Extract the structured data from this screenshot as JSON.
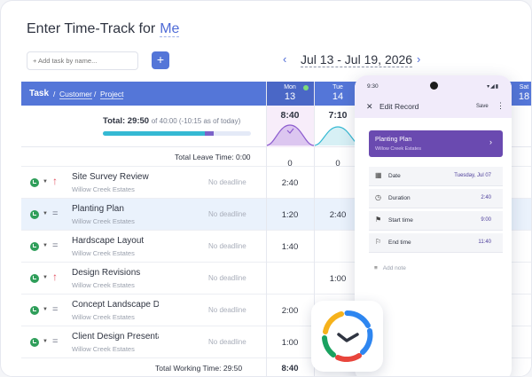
{
  "header": {
    "title_prefix": "Enter Time-Track for",
    "title_user": "Me",
    "add_task_placeholder": "+ Add task by name...",
    "add_button": "+",
    "date_range": "Jul 13 - Jul 19, 2026",
    "prev": "‹",
    "next": "›"
  },
  "table": {
    "col_task": "Task",
    "col_customer": "Customer",
    "col_project": "Project",
    "sep": "/",
    "days": [
      {
        "dow": "Mon",
        "num": "13"
      },
      {
        "dow": "Tue",
        "num": "14"
      },
      {
        "dow": "Sat",
        "num": "18"
      }
    ],
    "summary": {
      "label": "Total: 29:50",
      "sub": "of 40:00 (-10:15 as of today)",
      "progress_cyan": 0.69,
      "progress_purple": 0.06,
      "day_totals": [
        "8:40",
        "7:10"
      ]
    },
    "leave": {
      "label": "Total Leave Time: 0:00",
      "values": [
        "0",
        "0"
      ]
    },
    "rows": [
      {
        "name": "Site Survey Review",
        "client": "Willow Creek Estates",
        "deadline": "No deadline",
        "priority": "up",
        "mon": "2:40",
        "tue": ""
      },
      {
        "name": "Planting Plan",
        "client": "Willow Creek Estates",
        "deadline": "No deadline",
        "priority": "eq",
        "mon": "1:20",
        "tue": "2:40"
      },
      {
        "name": "Hardscape Layout",
        "client": "Willow Creek Estates",
        "deadline": "No deadline",
        "priority": "eq",
        "mon": "1:40",
        "tue": ""
      },
      {
        "name": "Design Revisions",
        "client": "Willow Creek Estates",
        "deadline": "No deadline",
        "priority": "up",
        "mon": "",
        "tue": "1:00"
      },
      {
        "name": "Concept Landscape Design",
        "client": "Willow Creek Estates",
        "deadline": "No deadline",
        "priority": "eq",
        "mon": "2:00",
        "tue": "0:40"
      },
      {
        "name": "Client Design Presentation",
        "client": "Willow Creek Estates",
        "deadline": "No deadline",
        "priority": "eq",
        "mon": "1:00",
        "tue": "1:00"
      }
    ],
    "total": {
      "label": "Total Working Time: 29:50",
      "values": [
        "8:40",
        "7:10"
      ]
    }
  },
  "phone": {
    "time": "9:30",
    "signal": "▾◢▮",
    "title": "Edit Record",
    "save": "Save",
    "more": "⋮",
    "close": "✕",
    "project": "Planting Plan",
    "client": "Willow Creek Estates",
    "chevron": "›",
    "fields": [
      {
        "icon": "calendar-icon",
        "glyph": "▦",
        "label": "Date",
        "value": "Tuesday, Jul 07"
      },
      {
        "icon": "clock-icon",
        "glyph": "◷",
        "label": "Duration",
        "value": "2:40"
      },
      {
        "icon": "flag-icon",
        "glyph": "⚑",
        "label": "Start time",
        "value": "9:00"
      },
      {
        "icon": "end-flag-icon",
        "glyph": "⚐",
        "label": "End time",
        "value": "11:40"
      }
    ],
    "note_glyph": "≡",
    "note": "Add note"
  },
  "colors": {
    "accent": "#5476d8",
    "purple": "#6a4ab0",
    "green": "#2f9e5a",
    "red": "#e04f5f"
  }
}
